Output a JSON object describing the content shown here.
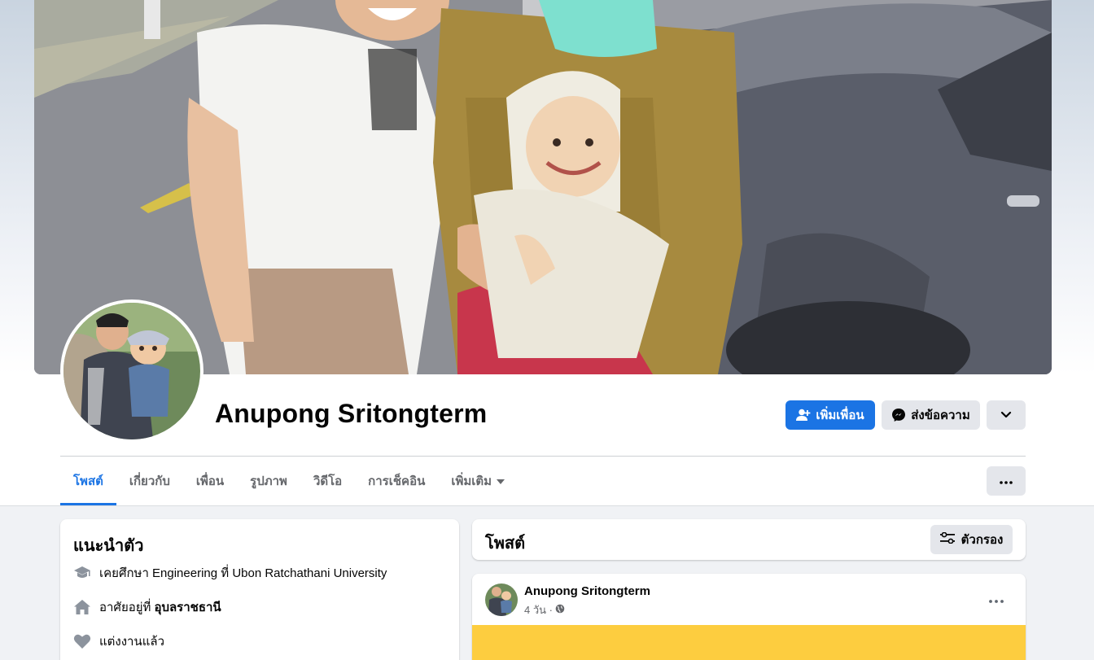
{
  "profile": {
    "name": "Anupong Sritongterm",
    "actions": {
      "add_friend_label": "เพิ่มเพื่อน",
      "message_label": "ส่งข้อความ"
    }
  },
  "tabs": [
    {
      "label": "โพสต์",
      "active": true
    },
    {
      "label": "เกี่ยวกับ"
    },
    {
      "label": "เพื่อน"
    },
    {
      "label": "รูปภาพ"
    },
    {
      "label": "วิดีโอ"
    },
    {
      "label": "การเช็คอิน"
    },
    {
      "label": "เพิ่มเติม",
      "has_dropdown": true
    }
  ],
  "intro": {
    "title": "แนะนำตัว",
    "education_prefix": "เคยศึกษา Engineering ที่ Ubon Ratchathani University",
    "location_prefix": "อาศัยอยู่ที่",
    "location_value": "อุบลราชธานี",
    "relationship": "แต่งงานแล้ว"
  },
  "posts_header": {
    "title": "โพสต์",
    "filter_label": "ตัวกรอง"
  },
  "post": {
    "author": "Anupong Sritongterm",
    "time": "4 วัน ·",
    "privacy_icon": "globe-icon",
    "image_color": "#fdcd3f"
  },
  "colors": {
    "accent": "#1b74e4",
    "secondary_button": "#e4e6eb",
    "page_bg": "#f0f2f5"
  }
}
